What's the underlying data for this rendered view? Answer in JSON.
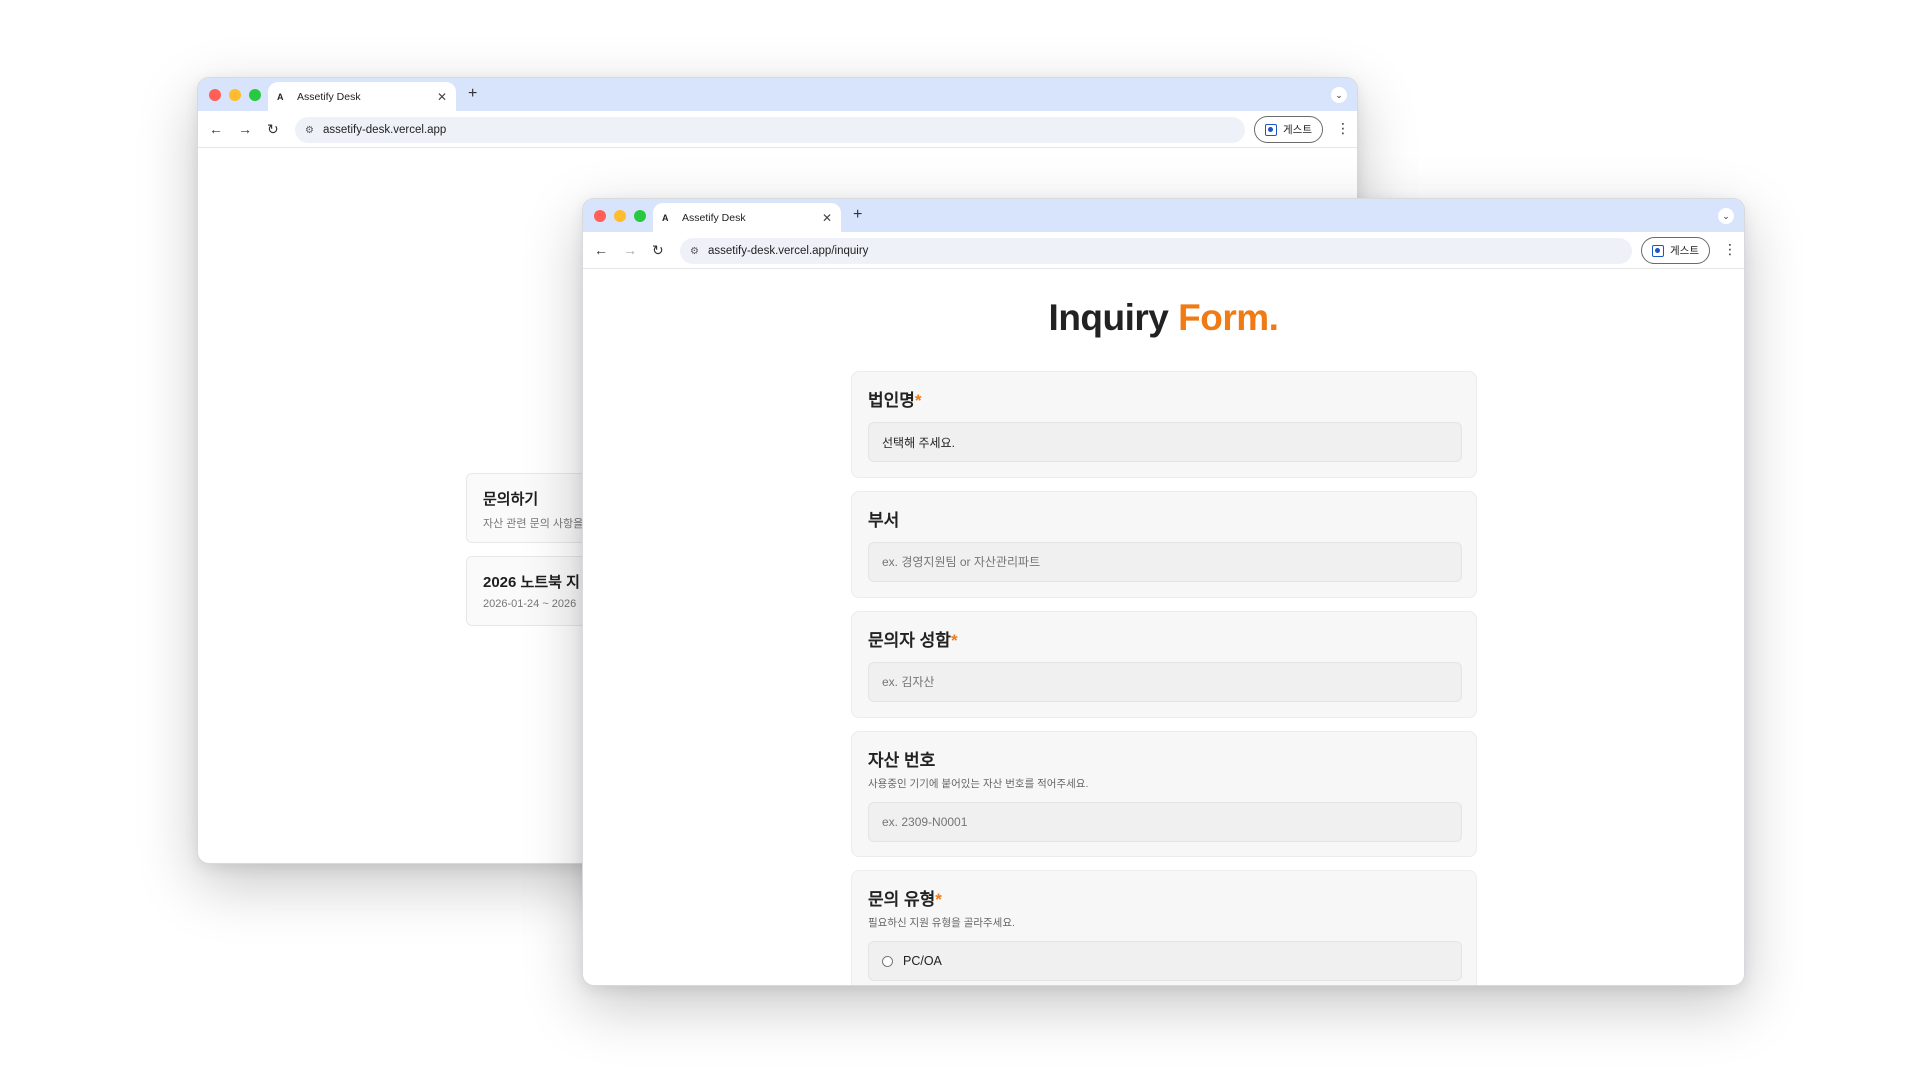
{
  "back_window": {
    "tab_title": "Assetify Desk",
    "favicon": "A",
    "url": "assetify-desk.vercel.app",
    "guest_label": "게스트",
    "cards": [
      {
        "title": "문의하기",
        "subtitle": "자산 관련 문의 사항을 "
      },
      {
        "title": "2026 노트북 지",
        "subtitle": "2026-01-24 ~ 2026"
      }
    ]
  },
  "front_window": {
    "tab_title": "Assetify Desk",
    "favicon": "A",
    "url": "assetify-desk.vercel.app/inquiry",
    "guest_label": "게스트"
  },
  "form": {
    "title_main": "Inquiry ",
    "title_accent": "Form.",
    "fields": {
      "corporation": {
        "label": "법인명",
        "required_mark": "*",
        "value": "선택해 주세요."
      },
      "department": {
        "label": "부서",
        "placeholder": "ex. 경영지원팀 or 자산관리파트"
      },
      "name": {
        "label": "문의자 성함",
        "required_mark": "*",
        "placeholder": "ex. 김자산"
      },
      "asset_number": {
        "label": "자산 번호",
        "help": "사용중인 기기에 붙어있는 자산 번호를 적어주세요.",
        "placeholder": "ex. 2309-N0001"
      },
      "inquiry_type": {
        "label": "문의 유형",
        "required_mark": "*",
        "help": "필요하신 지원 유형을 골라주세요.",
        "options": [
          "PC/OA"
        ]
      }
    }
  },
  "colors": {
    "accent": "#f07b14",
    "tabstrip": "#d7e4fb"
  },
  "icons": {
    "back": "arrow-left-icon",
    "forward": "arrow-right-icon",
    "reload": "reload-icon",
    "site_info": "tune-icon",
    "guest": "guest-profile-icon",
    "menu": "kebab-menu-icon"
  }
}
